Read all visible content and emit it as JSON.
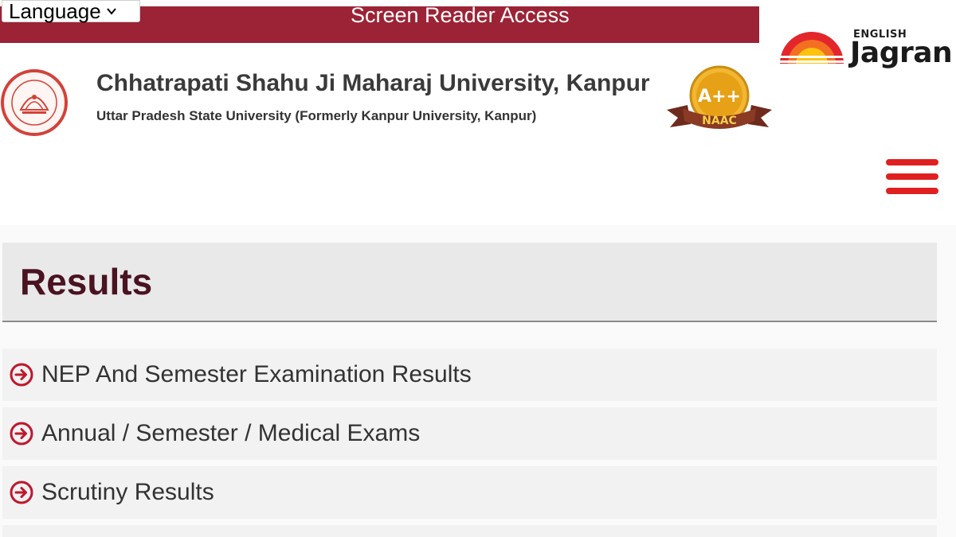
{
  "topbar": {
    "language_label": "Language",
    "screen_reader_label": "Screen Reader Access"
  },
  "brand": {
    "english_label": "ENGLISH",
    "jagran_label": "Jagran"
  },
  "university": {
    "name": "Chhatrapati Shahu Ji Maharaj University, Kanpur",
    "subtitle": "Uttar Pradesh State University (Formerly Kanpur University, Kanpur)"
  },
  "naac": {
    "grade": "A++",
    "label": "NAAC"
  },
  "colors": {
    "topbar": "#9b2335",
    "hamburger": "#e02020",
    "title": "#4a1321",
    "link_icon": "#c0162c"
  },
  "main": {
    "title": "Results",
    "items": [
      {
        "label": "NEP And Semester Examination Results",
        "icon": "circle-arrow-right-icon"
      },
      {
        "label": "Annual / Semester / Medical Exams",
        "icon": "circle-arrow-right-icon"
      },
      {
        "label": "Scrutiny Results",
        "icon": "circle-arrow-right-icon"
      }
    ]
  }
}
